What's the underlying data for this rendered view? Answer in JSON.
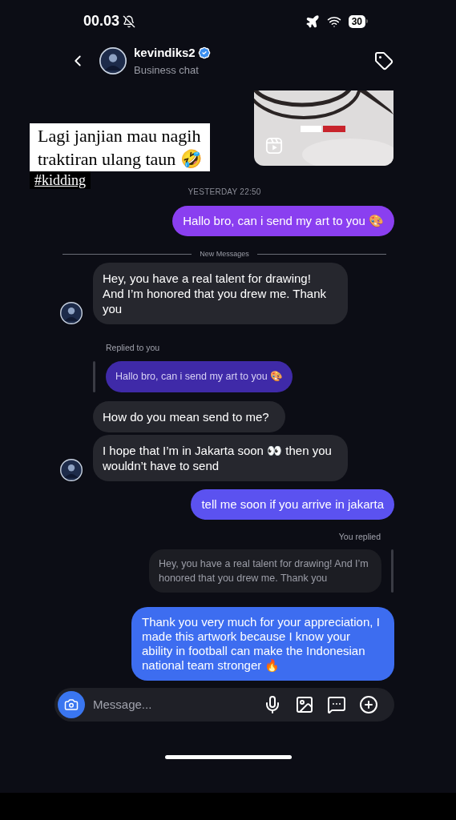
{
  "status_bar": {
    "time": "00.03",
    "battery": "30"
  },
  "header": {
    "username": "kevindiks2",
    "subtitle": "Business chat"
  },
  "story_caption": {
    "lines": [
      "Lagi janjian mau nagih",
      "traktiran ulang taun 🤣"
    ],
    "hashtag": "#kidding"
  },
  "messages": [
    {
      "kind": "timestamp",
      "text": "YESTERDAY 22:50"
    },
    {
      "kind": "sent",
      "text": "Hallo bro, can i send my art to you 🎨"
    },
    {
      "kind": "divider",
      "text": "New Messages"
    },
    {
      "kind": "received",
      "avatar": true,
      "text": "Hey, you have a real talent for drawing! And I’m honored that you drew me. Thank you"
    },
    {
      "kind": "reply_label",
      "text": "Replied to you"
    },
    {
      "kind": "quote_received",
      "text": "Hallo bro, can i send my art to you 🎨"
    },
    {
      "kind": "received",
      "avatar": false,
      "text": "How do you mean send to me?"
    },
    {
      "kind": "received",
      "avatar": true,
      "text": "I hope that I’m in Jakarta soon 👀 then you wouldn’t have to send"
    },
    {
      "kind": "sent",
      "text": "tell me soon if you arrive in jakarta"
    },
    {
      "kind": "reply_label_sent",
      "text": "You replied"
    },
    {
      "kind": "quote_sent",
      "text": "Hey, you have a real talent for drawing! And I’m honored that you drew me. Thank you"
    },
    {
      "kind": "sent",
      "text": "Thank you very much for your appreciation, I made this artwork because I know your ability in football can make the Indonesian national team stronger 🔥"
    }
  ],
  "composer": {
    "placeholder": "Message..."
  }
}
